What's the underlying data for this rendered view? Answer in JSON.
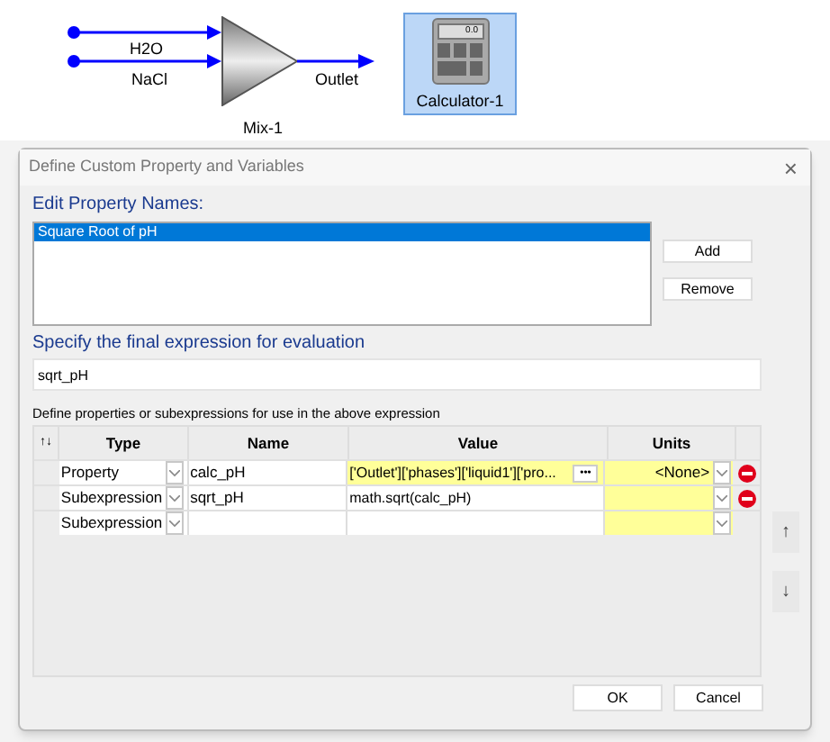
{
  "flowsheet": {
    "streams": [
      {
        "label": "H2O"
      },
      {
        "label": "NaCl"
      }
    ],
    "mixer": {
      "label": "Mix-1"
    },
    "outlet": {
      "label": "Outlet"
    },
    "calculator": {
      "label": "Calculator-1",
      "display": "0.0",
      "selected": true
    }
  },
  "dialog": {
    "title": "Define Custom Property and Variables",
    "close": "×",
    "names_heading": "Edit Property Names:",
    "names": [
      {
        "label": "Square Root of pH",
        "selected": true
      }
    ],
    "add_button": "Add",
    "remove_button": "Remove",
    "expression_heading": "Specify the final expression for evaluation",
    "expression": "sqrt_pH",
    "table_caption": "Define properties or subexpressions for use in the above expression",
    "columns": [
      "↑↓",
      "Type",
      "Name",
      "Value",
      "Units"
    ],
    "rows": [
      {
        "type": "Property",
        "name": "calc_pH",
        "value": "['Outlet']['phases']['liquid1']['pro...",
        "value_highlighted": true,
        "browse": "•••",
        "units": "<None>",
        "deletable": true
      },
      {
        "type": "Subexpression",
        "name": "sqrt_pH",
        "value": "math.sqrt(calc_pH)",
        "value_highlighted": false,
        "units": "",
        "deletable": true
      },
      {
        "type": "Subexpression",
        "name": "",
        "value": "",
        "value_highlighted": false,
        "units": "",
        "deletable": false
      }
    ],
    "move_up": "↑",
    "move_down": "↓",
    "ok_button": "OK",
    "cancel_button": "Cancel"
  }
}
